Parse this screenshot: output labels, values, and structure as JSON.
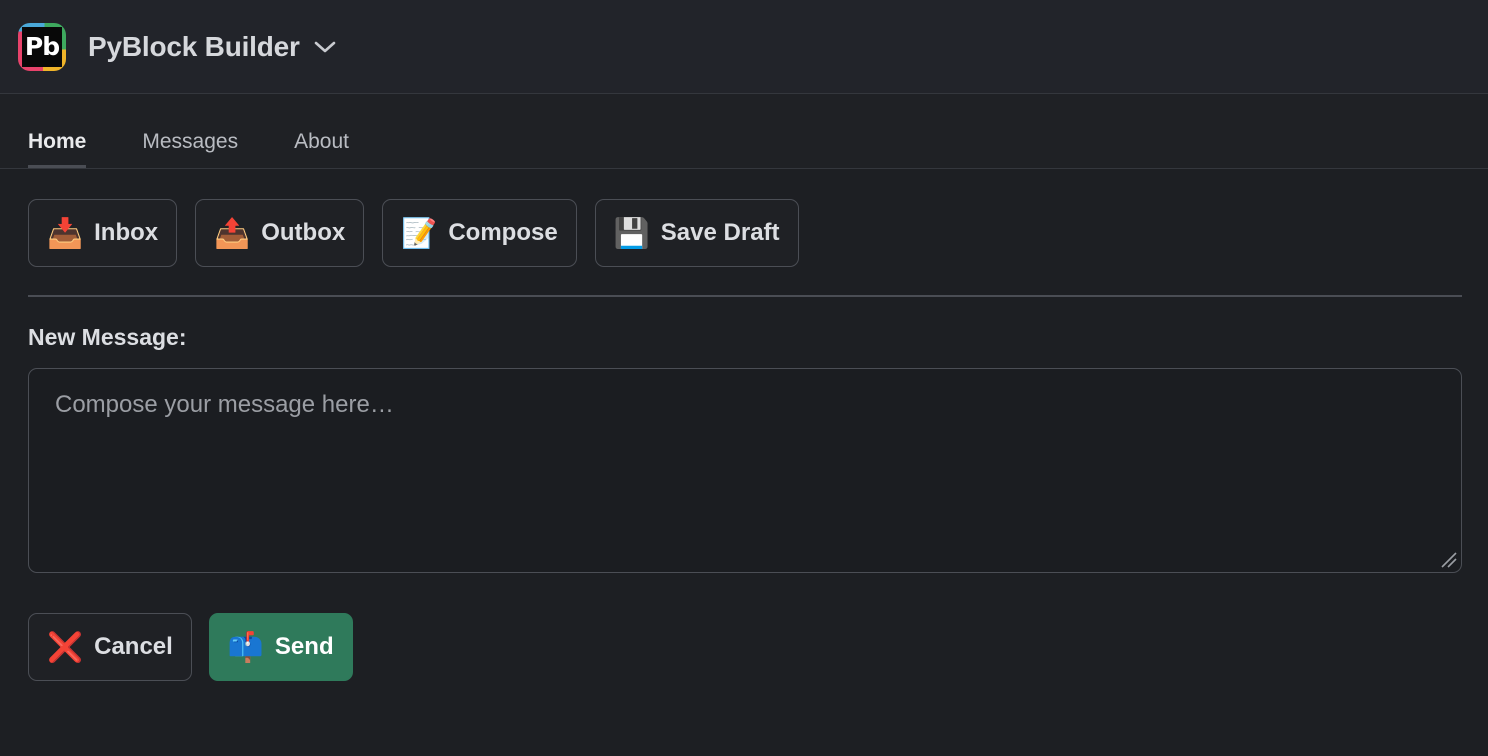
{
  "header": {
    "logo_text": "Pb",
    "logo_name": "pyblock-logo",
    "title": "PyBlock Builder",
    "chevron_icon": "chevron-down-icon"
  },
  "tabs": [
    {
      "label": "Home",
      "active": true
    },
    {
      "label": "Messages",
      "active": false
    },
    {
      "label": "About",
      "active": false
    }
  ],
  "toolbar": {
    "buttons": [
      {
        "label": "Inbox",
        "emoji": "📥",
        "icon_name": "inbox-tray-icon"
      },
      {
        "label": "Outbox",
        "emoji": "📤",
        "icon_name": "outbox-tray-icon"
      },
      {
        "label": "Compose",
        "emoji": "📝",
        "icon_name": "memo-pencil-icon"
      },
      {
        "label": "Save Draft",
        "emoji": "💾",
        "icon_name": "floppy-disk-icon"
      }
    ]
  },
  "form": {
    "label": "New Message:",
    "message_value": "",
    "message_placeholder": "Compose your message here…"
  },
  "actions": {
    "cancel": {
      "label": "Cancel",
      "emoji": "❌",
      "icon_name": "cross-mark-icon"
    },
    "send": {
      "label": "Send",
      "emoji": "📫",
      "icon_name": "mailbox-icon"
    }
  },
  "colors": {
    "page_background": "#1d1f23",
    "header_background": "#22242a",
    "border": "#4b4e55",
    "send_accent": "#2f7a5b",
    "text_primary": "#dcdee2",
    "text_muted": "#9b9ea4"
  }
}
